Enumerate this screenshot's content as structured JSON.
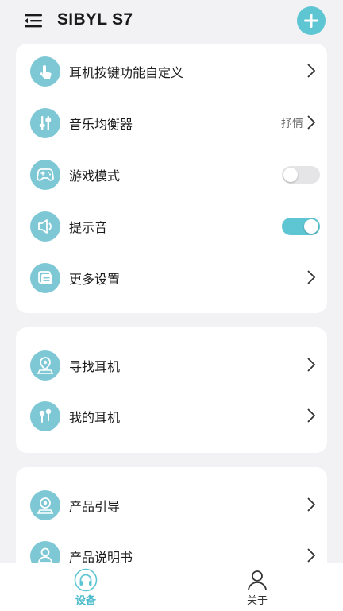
{
  "header": {
    "title": "SIBYL S7"
  },
  "settings_card": {
    "items": [
      {
        "label": "耳机按键功能自定义",
        "icon": "touch-icon"
      },
      {
        "label": "音乐均衡器",
        "icon": "equalizer-icon",
        "value": "抒情"
      },
      {
        "label": "游戏模式",
        "icon": "gamepad-icon",
        "toggle": false
      },
      {
        "label": "提示音",
        "icon": "speaker-icon",
        "toggle": true
      },
      {
        "label": "更多设置",
        "icon": "more-settings-icon"
      }
    ]
  },
  "device_card": {
    "items": [
      {
        "label": "寻找耳机",
        "icon": "locate-icon"
      },
      {
        "label": "我的耳机",
        "icon": "earbuds-icon"
      }
    ]
  },
  "help_card": {
    "items": [
      {
        "label": "产品引导",
        "icon": "guide-icon"
      },
      {
        "label": "产品说明书",
        "icon": "manual-icon"
      }
    ]
  },
  "tabbar": {
    "tabs": [
      {
        "label": "设备",
        "icon": "headphones-icon",
        "active": true
      },
      {
        "label": "关于",
        "icon": "user-icon",
        "active": false
      }
    ]
  },
  "colors": {
    "accent": "#5ec6d3",
    "icon_bg": "#7ec8d5",
    "background": "#f2f2f4"
  }
}
